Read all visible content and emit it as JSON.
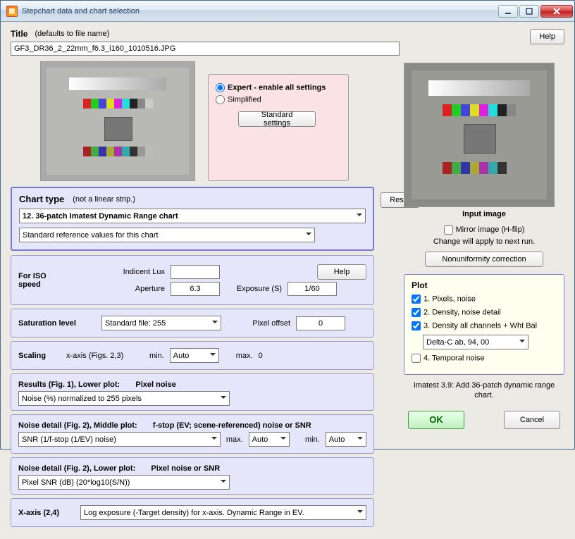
{
  "window_title": "Stepchart data and chart selection",
  "help_label": "Help",
  "title_section": {
    "label": "Title",
    "hint": "(defaults to file name)",
    "value": "GF3_DR36_2_22mm_f6.3_i160_1010516.JPG"
  },
  "mode": {
    "expert": "Expert - enable all settings",
    "simplified": "Simplified",
    "standard_btn": "Standard settings"
  },
  "chart_type": {
    "label": "Chart type",
    "hint": "(not a linear strip.)",
    "reset": "Reset",
    "selected": "12. 36-patch Imatest Dynamic Range chart",
    "ref": "Standard reference values for this chart"
  },
  "iso": {
    "label": "For ISO speed",
    "incident_label": "Indicent Lux",
    "incident_value": "",
    "aperture_label": "Aperture",
    "aperture_value": "6.3",
    "exposure_label": "Exposure (S)",
    "exposure_value": "1/60",
    "help": "Help"
  },
  "sat": {
    "label": "Saturation level",
    "value": "Standard file: 255",
    "pixel_offset_label": "Pixel offset",
    "pixel_offset_value": "0"
  },
  "scaling": {
    "label": "Scaling",
    "xaxis": "x-axis (Figs. 2,3)",
    "min_label": "min.",
    "min_value": "Auto",
    "max_label": "max.",
    "max_value": "0"
  },
  "results1": {
    "label": "Results (Fig. 1), Lower plot:",
    "sub": "Pixel noise",
    "value": "Noise (%) normalized to 255 pixels"
  },
  "noise2mid": {
    "label": "Noise detail (Fig. 2), Middle plot:",
    "sub": "f-stop (EV; scene-referenced) noise or SNR",
    "value": "SNR (1/f-stop (1/EV) noise)",
    "max_label": "max.",
    "max_value": "Auto",
    "min_label": "min.",
    "min_value": "Auto"
  },
  "noise2low": {
    "label": "Noise detail (Fig. 2), Lower plot:",
    "sub": "Pixel noise or SNR",
    "value": "Pixel SNR (dB)  (20*log10(S/N))"
  },
  "xaxis24": {
    "label": "X-axis (2,4)",
    "value": "Log exposure (-Target density) for x-axis.     Dynamic Range in EV."
  },
  "input_image_caption": "Input image",
  "mirror": {
    "checkbox": "Mirror image (H-flip)",
    "note": "Change will apply to next run.",
    "btn": "Nonuniformity correction"
  },
  "plot": {
    "label": "Plot",
    "o1": "1. Pixels, noise",
    "o2": "2. Density, noise detail",
    "o3": "3. Density all channels + Wht Bal",
    "o3val": "Delta-C ab, 94, 00",
    "o4": "4. Temporal noise"
  },
  "footer": "Imatest 3.9: Add 36-patch dynamic range chart.",
  "ok": "OK",
  "cancel": "Cancel"
}
